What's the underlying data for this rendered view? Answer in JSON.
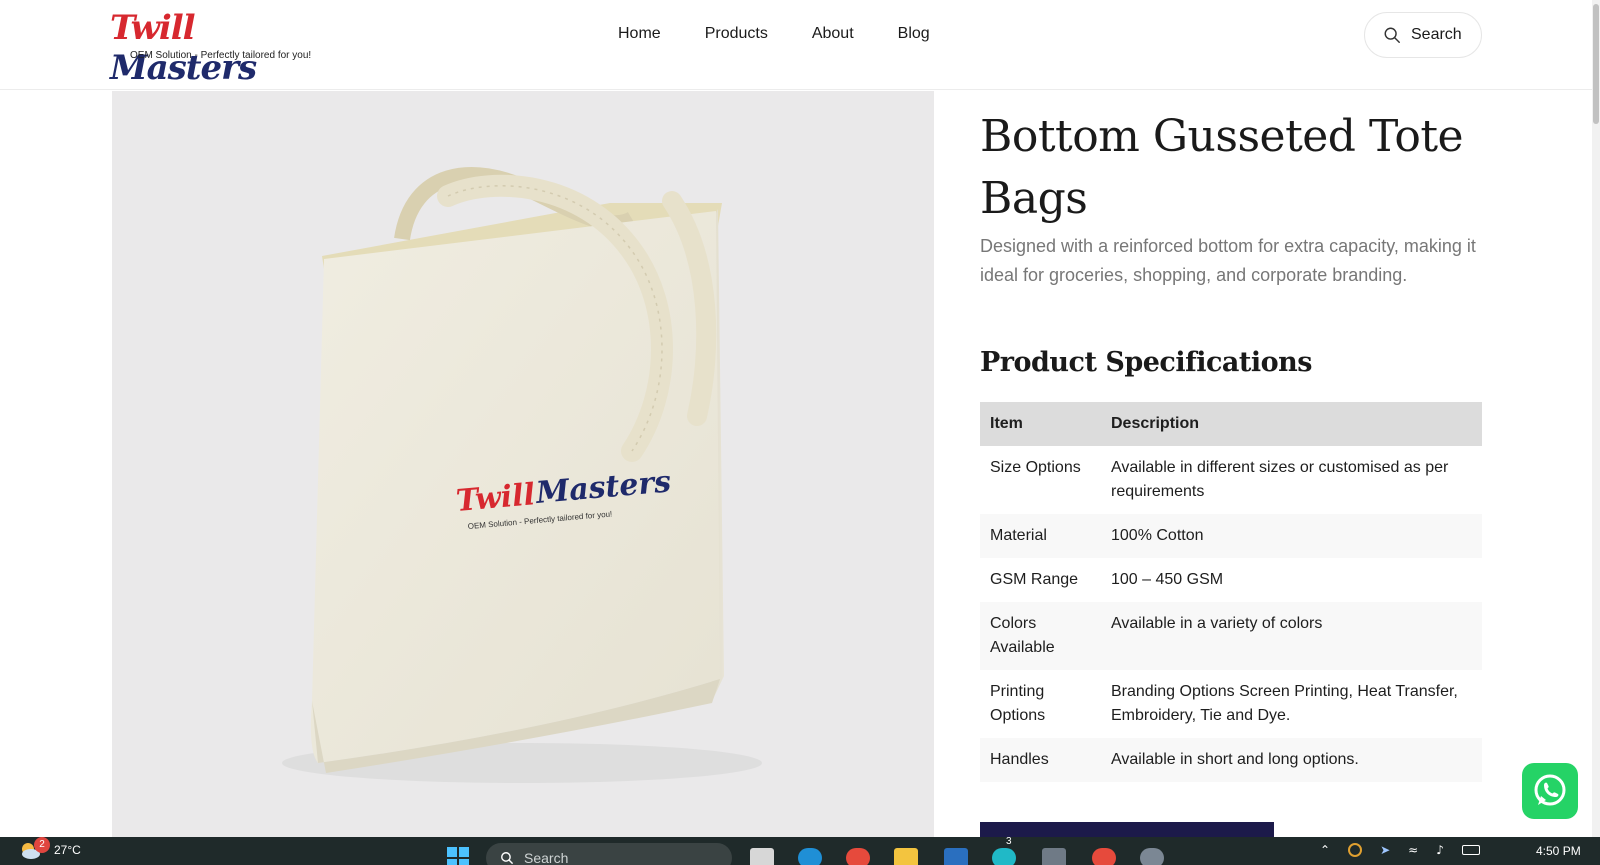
{
  "brand": {
    "name_part1": "Twill",
    "name_part2": "Masters",
    "tagline": "OEM Solution - Perfectly tailored for you!"
  },
  "nav": {
    "items": [
      {
        "label": "Home"
      },
      {
        "label": "Products"
      },
      {
        "label": "About"
      },
      {
        "label": "Blog"
      }
    ]
  },
  "search": {
    "label": "Search"
  },
  "product": {
    "title": "Bottom Gusseted Tote Bags",
    "description": "Designed with a reinforced bottom for extra capacity, making it ideal for groceries, shopping, and corporate branding.",
    "image_logo_part1": "Twill",
    "image_logo_part2": "Masters",
    "image_logo_tagline": "OEM Solution - Perfectly tailored for you!"
  },
  "specs": {
    "heading": "Product Specifications",
    "columns": [
      "Item",
      "Description"
    ],
    "rows": [
      {
        "item": "Size Options",
        "description": "Available in different sizes or customised as per requirements"
      },
      {
        "item": "Material",
        "description": "100% Cotton"
      },
      {
        "item": "GSM Range",
        "description": "100 – 450 GSM"
      },
      {
        "item": "Colors Available",
        "description": "Available in a variety of colors"
      },
      {
        "item": "Printing Options",
        "description": "Branding Options Screen Printing, Heat Transfer, Embroidery, Tie and Dye."
      },
      {
        "item": "Handles",
        "description": "Available in short and long options."
      }
    ]
  },
  "taskbar": {
    "weather_badge": "2",
    "temperature": "27°C",
    "search_label": "Search",
    "canva_badge": "3",
    "clock": "4:50 PM"
  },
  "colors": {
    "brand_red": "#d7282f",
    "brand_navy": "#1f2a6b",
    "cta": "#1c1a4a",
    "whatsapp": "#25d366"
  }
}
